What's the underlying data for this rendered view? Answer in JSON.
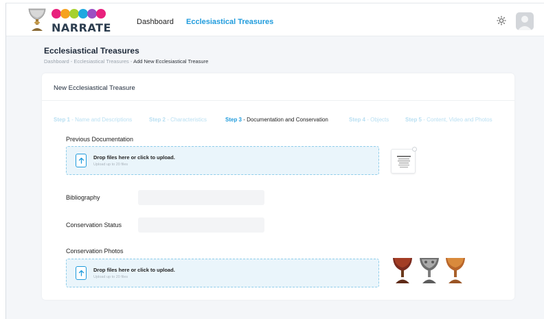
{
  "header": {
    "brand": "NARRATE",
    "brand_colors": [
      "#e8217d",
      "#f6a21e",
      "#a6d12f",
      "#1fa8e0",
      "#9b4fc4",
      "#e8217d"
    ],
    "nav": {
      "dashboard": "Dashboard",
      "treasures": "Ecclesiastical Treasures"
    },
    "theme_icon": "sun-icon",
    "avatar_icon": "user-avatar"
  },
  "page": {
    "title": "Ecclesiastical Treasures",
    "breadcrumb": {
      "prefix": "Dashboard - Ecclesiastical Treasures - ",
      "current": "Add New Ecclesiastical Treasure"
    }
  },
  "form": {
    "title": "New Ecclesiastical Treasure",
    "steps": [
      {
        "num": "Step 1",
        "label": " - Name and Descriptions"
      },
      {
        "num": "Step 2",
        "label": " - Characteristics"
      },
      {
        "num": "Step 3",
        "label": " - Documentation and Conservation"
      },
      {
        "num": "Step 4",
        "label": " - Objects"
      },
      {
        "num": "Step 5",
        "label": " - Content, Video and Photos"
      }
    ],
    "active_step": 3,
    "previous_documentation": {
      "label": "Previous Documentation",
      "drop_title": "Drop files here or click to upload.",
      "drop_sub": "Upload up to 20 files"
    },
    "bibliography": {
      "label": "Bibliography",
      "value": ""
    },
    "conservation_status": {
      "label": "Conservation Status",
      "value": ""
    },
    "conservation_photos": {
      "label": "Conservation Photos",
      "drop_title": "Drop files here or click to upload.",
      "drop_sub": "Upload up to 20 files"
    }
  },
  "colors": {
    "accent": "#1f9bdc",
    "inactive_step": "#b8dff2",
    "dropzone_bg": "#eaf5fb"
  }
}
